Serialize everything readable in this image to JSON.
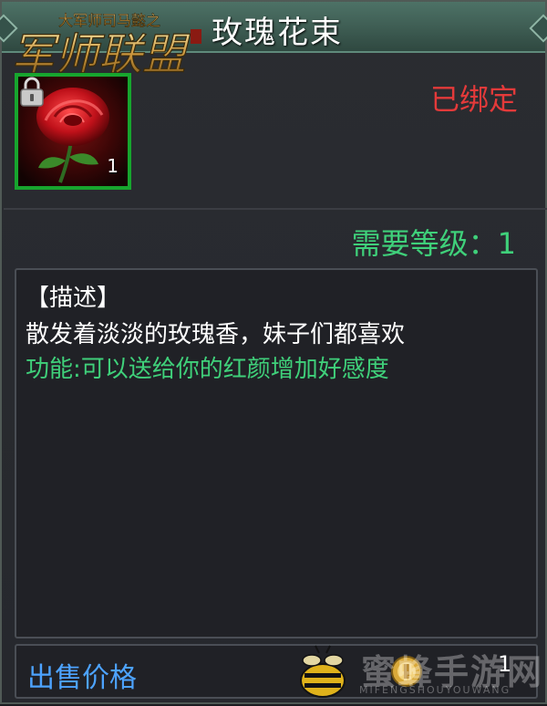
{
  "header": {
    "title": "玫瑰花束",
    "logo_text": "军师联盟",
    "logo_subtitle": "大军师司马懿之"
  },
  "item": {
    "icon": "rose-icon",
    "lock_icon": "lock-icon",
    "quantity": "1",
    "bound_status": "已绑定",
    "required_level": "需要等级：1"
  },
  "description": {
    "heading": "【描述】",
    "text": "散发着淡淡的玫瑰香，妹子们都喜欢",
    "function": "功能:可以送给你的红颜增加好感度"
  },
  "price": {
    "label": "出售价格",
    "coin_icon": "coin-icon",
    "value": "1"
  },
  "watermark": {
    "text": "蜜蜂手游网",
    "sub": "MIFENGSHOUYOUWANG"
  },
  "colors": {
    "header_bg": "#3f5e54",
    "item_border": "#17a52e",
    "bound": "#e33a3a",
    "green_text": "#3fd07a",
    "price_label": "#4da3ff"
  }
}
